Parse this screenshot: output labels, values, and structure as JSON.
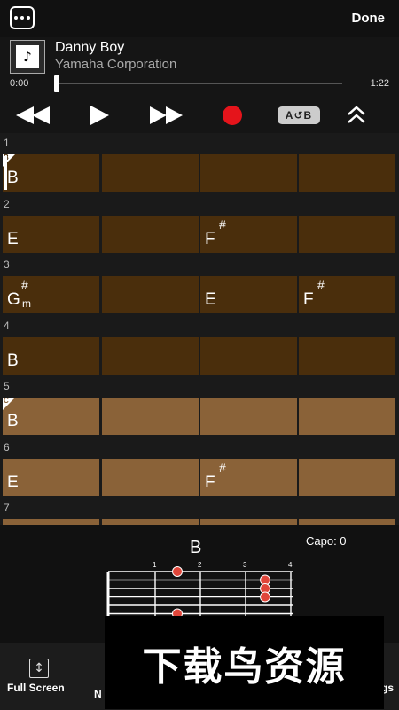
{
  "topbar": {
    "done_label": "Done"
  },
  "song": {
    "title": "Danny Boy",
    "artist": "Yamaha Corporation",
    "time_current": "0:00",
    "time_total": "1:22",
    "progress_fraction": 0.0
  },
  "controls": {
    "ab_label": "A↺B",
    "record_color": "#e5141b"
  },
  "bars": [
    {
      "number": "1",
      "marker": "B",
      "shade": "dark",
      "cursor": true,
      "chords": [
        {
          "pos": 0,
          "root": "B",
          "sharp": "",
          "minor": ""
        }
      ]
    },
    {
      "number": "2",
      "marker": "",
      "shade": "dark",
      "cursor": false,
      "chords": [
        {
          "pos": 0,
          "root": "E",
          "sharp": "",
          "minor": ""
        },
        {
          "pos": 2,
          "root": "F",
          "sharp": "#",
          "minor": ""
        }
      ]
    },
    {
      "number": "3",
      "marker": "",
      "shade": "dark",
      "cursor": false,
      "chords": [
        {
          "pos": 0,
          "root": "G",
          "sharp": "#",
          "minor": "m"
        },
        {
          "pos": 2,
          "root": "E",
          "sharp": "",
          "minor": ""
        },
        {
          "pos": 3,
          "root": "F",
          "sharp": "#",
          "minor": ""
        }
      ]
    },
    {
      "number": "4",
      "marker": "",
      "shade": "dark",
      "cursor": false,
      "chords": [
        {
          "pos": 0,
          "root": "B",
          "sharp": "",
          "minor": ""
        }
      ]
    },
    {
      "number": "5",
      "marker": "C",
      "shade": "light",
      "cursor": false,
      "chords": [
        {
          "pos": 0,
          "root": "B",
          "sharp": "",
          "minor": ""
        }
      ]
    },
    {
      "number": "6",
      "marker": "",
      "shade": "light",
      "cursor": false,
      "chords": [
        {
          "pos": 0,
          "root": "E",
          "sharp": "",
          "minor": ""
        },
        {
          "pos": 2,
          "root": "F",
          "sharp": "#",
          "minor": ""
        }
      ]
    },
    {
      "number": "7",
      "marker": "",
      "shade": "light",
      "cursor": false,
      "chords": []
    }
  ],
  "diagram": {
    "chord": "B",
    "capo_label": "Capo: 0",
    "fret_numbers": [
      "1",
      "2",
      "3",
      "4"
    ],
    "dot_color": "#e0463a"
  },
  "toolbar": {
    "full_screen_label": "Full Screen",
    "left_partial_label": "N",
    "right_partial_label": "gs"
  },
  "watermark": {
    "text": "下载鸟资源"
  },
  "colors": {
    "bar_dark": "#4a2e0c",
    "bar_light": "#8a6238"
  }
}
